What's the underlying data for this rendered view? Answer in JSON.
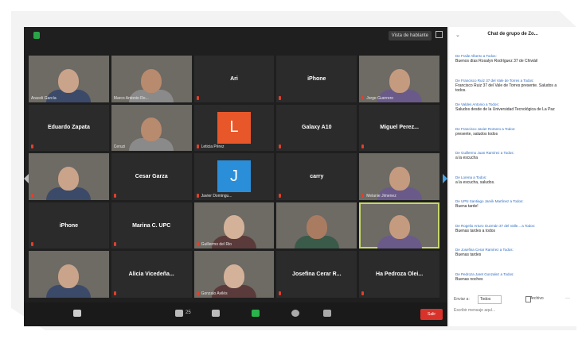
{
  "meeting": {
    "view_button": "Vista de hablante",
    "tiles": [
      {
        "label": "Araceli García",
        "type": "video",
        "mic": false
      },
      {
        "label": "Marco Antonio Ro...",
        "type": "video",
        "mic": false
      },
      {
        "label": "Ari",
        "type": "name",
        "mic": true
      },
      {
        "label": "iPhone",
        "type": "name",
        "mic": true
      },
      {
        "label": "Jorge Guerrero",
        "type": "video",
        "mic": true
      },
      {
        "label": "Eduardo Zapata",
        "type": "name",
        "mic": true
      },
      {
        "label": "Ceruzi",
        "type": "video",
        "mic": false
      },
      {
        "label": "Leticia Pérez",
        "type": "letter",
        "letter": "L",
        "color": "#e8572a",
        "mic": true
      },
      {
        "label": "Galaxy A10",
        "type": "name",
        "mic": true
      },
      {
        "label": "Miguel Perez...",
        "type": "name",
        "mic": true
      },
      {
        "label": "",
        "type": "video",
        "mic": true
      },
      {
        "label": "Cesar Garza",
        "type": "name",
        "mic": true
      },
      {
        "label": "Javier Domingu...",
        "type": "letter",
        "letter": "J",
        "color": "#2b8ed8",
        "mic": true
      },
      {
        "label": "carry",
        "type": "name",
        "mic": true
      },
      {
        "label": "Melanie Jimenez",
        "type": "video",
        "mic": true
      },
      {
        "label": "iPhone",
        "type": "name",
        "mic": true
      },
      {
        "label": "Marina C. UPC",
        "type": "name",
        "mic": true
      },
      {
        "label": "Guillermo del Rio",
        "type": "video",
        "mic": true
      },
      {
        "label": "",
        "type": "video",
        "mic": false
      },
      {
        "label": "",
        "type": "video",
        "mic": false,
        "active": true
      },
      {
        "label": "",
        "type": "video",
        "mic": false
      },
      {
        "label": "Alicia Vicedeña...",
        "type": "name",
        "mic": true
      },
      {
        "label": "Gonzalo Avilés",
        "type": "video",
        "mic": true
      },
      {
        "label": "Josefina Cerar R...",
        "type": "name",
        "mic": true
      },
      {
        "label": "Ha Pedroza Olei...",
        "type": "name",
        "mic": true
      }
    ],
    "participants_count": "25",
    "end_button": "Salir"
  },
  "chat": {
    "title": "Chat de grupo de Zo...",
    "messages": [
      {
        "from": "De Fraile Alberto a Todos:",
        "text": "Buenos días Rosalyn Rodríguez 37 de Chiviáil"
      },
      {
        "from": "De Francisco Ruíz 37 del Vale de Torres a Todos:",
        "text": "Francisco Ruiz 37 del Vale de Torres presente. Saludos a todos."
      },
      {
        "from": "De Valdes Antonio a Todos:",
        "text": "Saludos desde de la Universidad Tecnológica de La Paz"
      },
      {
        "from": "De Francisco Javier Romero a Todos:",
        "text": "presente, saludos todos"
      },
      {
        "from": "De Guillermo Juan Ramírez a Todos:",
        "text": "a la escucha"
      },
      {
        "from": "De Lorena a Todos:",
        "text": "a la escucha, saludos."
      },
      {
        "from": "De UPN Santiago Jarvik Martínez a Todos:",
        "text": "Buena tarde!"
      },
      {
        "from": "De Rogelio Arturo Guzmán 37 del Valle... a Todos:",
        "text": "Buenas tardes a todos"
      },
      {
        "from": "De Josefina Cerar Ramírez a Todos:",
        "text": "Buenas tardes"
      },
      {
        "from": "De Pedroza Jaret Gonzalez a Todos:",
        "text": "Buenas noches"
      }
    ],
    "to_label": "Enviar a:",
    "to_value": "Todos",
    "file_label": "Archivo",
    "more_label": "···",
    "input_placeholder": "Escribir mensaje aquí..."
  }
}
